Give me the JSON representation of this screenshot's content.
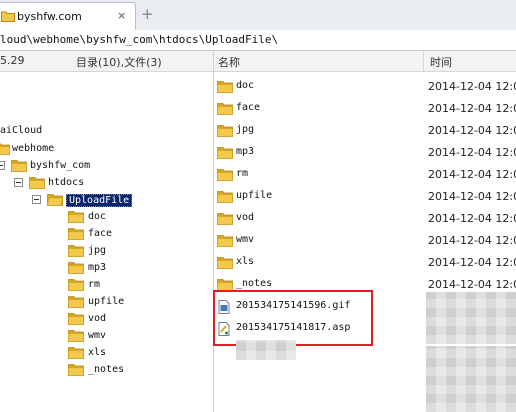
{
  "tabs": [
    {
      "label": "byshfw.com",
      "close": "×"
    }
  ],
  "tab_add": "+",
  "address_path": "loud\\webhome\\byshfw_com\\htdocs\\UploadFile\\",
  "left_header": {
    "version": "5.29",
    "summary": "目录(10),文件(3)"
  },
  "columns": {
    "name": "名称",
    "time": "时间"
  },
  "tree": [
    {
      "label": "aiCloud"
    },
    {
      "label": "webhome"
    },
    {
      "label": "byshfw_com"
    },
    {
      "label": "htdocs"
    },
    {
      "label": "UploadFile"
    },
    {
      "label": "doc"
    },
    {
      "label": "face"
    },
    {
      "label": "jpg"
    },
    {
      "label": "mp3"
    },
    {
      "label": "rm"
    },
    {
      "label": "upfile"
    },
    {
      "label": "vod"
    },
    {
      "label": "wmv"
    },
    {
      "label": "xls"
    },
    {
      "label": "_notes"
    }
  ],
  "files": [
    {
      "name": "doc",
      "date": "2014-12-04 12:0",
      "icon": "folder-icon"
    },
    {
      "name": "face",
      "date": "2014-12-04 12:0",
      "icon": "folder-icon"
    },
    {
      "name": "jpg",
      "date": "2014-12-04 12:0",
      "icon": "folder-icon"
    },
    {
      "name": "mp3",
      "date": "2014-12-04 12:0",
      "icon": "folder-icon"
    },
    {
      "name": "rm",
      "date": "2014-12-04 12:0",
      "icon": "folder-icon"
    },
    {
      "name": "upfile",
      "date": "2014-12-04 12:0",
      "icon": "folder-icon"
    },
    {
      "name": "vod",
      "date": "2014-12-04 12:0",
      "icon": "folder-icon"
    },
    {
      "name": "wmv",
      "date": "2014-12-04 12:0",
      "icon": "folder-icon"
    },
    {
      "name": "xls",
      "date": "2014-12-04 12:0",
      "icon": "folder-icon"
    },
    {
      "name": "_notes",
      "date": "2014-12-04 12:0",
      "icon": "folder-icon"
    },
    {
      "name": "201534175141596.gif",
      "icon": "gif-file-icon"
    },
    {
      "name": "201534175141817.asp",
      "icon": "script-file-icon"
    }
  ],
  "colors": {
    "folder": "#f2c94c",
    "folder_dark": "#d9a521",
    "selection": "#0a246a",
    "highlight_box": "#e02020"
  }
}
